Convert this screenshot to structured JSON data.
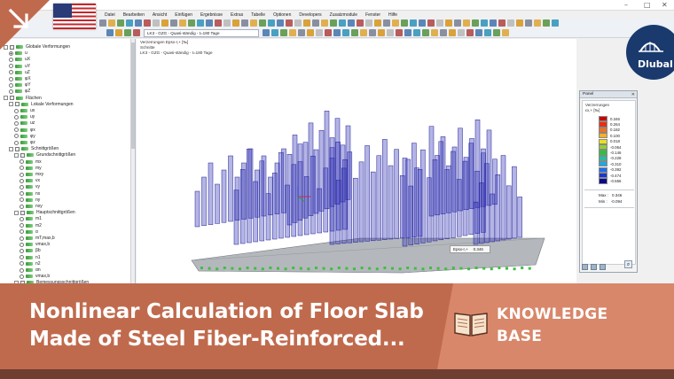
{
  "window": {
    "menu": [
      "Datei",
      "Bearbeiten",
      "Ansicht",
      "Einfügen",
      "Ergebnisse",
      "Extras",
      "Tabelle",
      "Optionen",
      "Developers",
      "Zusatzmodule",
      "Fenster",
      "Hilfe"
    ],
    "load_case": "LK3 - GZG - Quasi-ständig - t=180 Tage",
    "minimize_glyph": "–",
    "maximize_glyph": "□",
    "close_glyph": "✕"
  },
  "navigator": {
    "items": [
      {
        "label": "Globale Verformungen",
        "level": 0,
        "kind": "check",
        "expand": true
      },
      {
        "label": "u",
        "level": 1,
        "kind": "radio"
      },
      {
        "label": "uX",
        "level": 1,
        "kind": "radio"
      },
      {
        "label": "uY",
        "level": 1,
        "kind": "radio"
      },
      {
        "label": "uZ",
        "level": 1,
        "kind": "radio"
      },
      {
        "label": "φX",
        "level": 1,
        "kind": "radio"
      },
      {
        "label": "φY",
        "level": 1,
        "kind": "radio"
      },
      {
        "label": "φZ",
        "level": 1,
        "kind": "radio"
      },
      {
        "label": "Flächen",
        "level": 0,
        "kind": "check",
        "expand": true
      },
      {
        "label": "Lokale Verformungen",
        "level": 1,
        "kind": "check",
        "expand": true
      },
      {
        "label": "ux",
        "level": 2,
        "kind": "radio"
      },
      {
        "label": "uy",
        "level": 2,
        "kind": "radio"
      },
      {
        "label": "uz",
        "level": 2,
        "kind": "radio"
      },
      {
        "label": "φx",
        "level": 2,
        "kind": "radio"
      },
      {
        "label": "φy",
        "level": 2,
        "kind": "radio"
      },
      {
        "label": "φz",
        "level": 2,
        "kind": "radio"
      },
      {
        "label": "Schnittgrößen",
        "level": 1,
        "kind": "check",
        "expand": true
      },
      {
        "label": "Grundschnittgrößen",
        "level": 2,
        "kind": "check",
        "expand": true
      },
      {
        "label": "mx",
        "level": 3,
        "kind": "radio"
      },
      {
        "label": "my",
        "level": 3,
        "kind": "radio"
      },
      {
        "label": "mxy",
        "level": 3,
        "kind": "radio"
      },
      {
        "label": "vx",
        "level": 3,
        "kind": "radio"
      },
      {
        "label": "vy",
        "level": 3,
        "kind": "radio"
      },
      {
        "label": "nx",
        "level": 3,
        "kind": "radio"
      },
      {
        "label": "ny",
        "level": 3,
        "kind": "radio"
      },
      {
        "label": "nxy",
        "level": 3,
        "kind": "radio"
      },
      {
        "label": "Hauptschnittgrößen",
        "level": 2,
        "kind": "check",
        "expand": true
      },
      {
        "label": "m1",
        "level": 3,
        "kind": "radio"
      },
      {
        "label": "m2",
        "level": 3,
        "kind": "radio"
      },
      {
        "label": "α",
        "level": 3,
        "kind": "radio"
      },
      {
        "label": "mT,max,b",
        "level": 3,
        "kind": "radio"
      },
      {
        "label": "vmax,b",
        "level": 3,
        "kind": "radio"
      },
      {
        "label": "βb",
        "level": 3,
        "kind": "radio"
      },
      {
        "label": "n1",
        "level": 3,
        "kind": "radio"
      },
      {
        "label": "n2",
        "level": 3,
        "kind": "radio"
      },
      {
        "label": "αn",
        "level": 3,
        "kind": "radio"
      },
      {
        "label": "vmax,b",
        "level": 3,
        "kind": "radio"
      },
      {
        "label": "Bemessungsschnittgrößen",
        "level": 2,
        "kind": "check",
        "expand": true
      }
    ]
  },
  "viewport": {
    "info_lines": [
      "Verzerrungen Epsx-r,+ [‰]",
      "Schnitte",
      "LK3 - GZG - Quasi-ständig - t=180 Tage"
    ],
    "readout_label": "Epsx-r,+",
    "readout_value": "0.346"
  },
  "panel": {
    "title": "Panel",
    "close_glyph": "✕",
    "subtitle_1": "Verzerrungen",
    "subtitle_2": "εx,+ [‰]",
    "scale": [
      {
        "value": "0.346",
        "color": "#cc0000"
      },
      {
        "value": "0.264",
        "color": "#e83010"
      },
      {
        "value": "0.182",
        "color": "#f07020"
      },
      {
        "value": "0.100",
        "color": "#f8b020"
      },
      {
        "value": "0.018",
        "color": "#e8e020"
      },
      {
        "value": "-0.064",
        "color": "#90d030"
      },
      {
        "value": "-0.146",
        "color": "#30c040"
      },
      {
        "value": "-0.228",
        "color": "#20c0a0"
      },
      {
        "value": "-0.310",
        "color": "#20a8e0"
      },
      {
        "value": "-0.392",
        "color": "#2070e8"
      },
      {
        "value": "-0.474",
        "color": "#1838d0"
      },
      {
        "value": "-0.556",
        "color": "#0a0a90"
      }
    ],
    "max_label": "Max :",
    "max_value": "0.346",
    "min_label": "Min :",
    "min_value": "-0.094"
  },
  "overlay": {
    "brand": "Dlubal",
    "language_flag": "us-flag",
    "headline_line1": "Nonlinear Calculation of Floor Slab",
    "headline_line2": "Made of Steel Fiber-Reinforced...",
    "category_line1": "KNOWLEDGE",
    "category_line2": "BASE",
    "brand_color": "#1a3a6e",
    "banner_color": "#c06a4d"
  }
}
